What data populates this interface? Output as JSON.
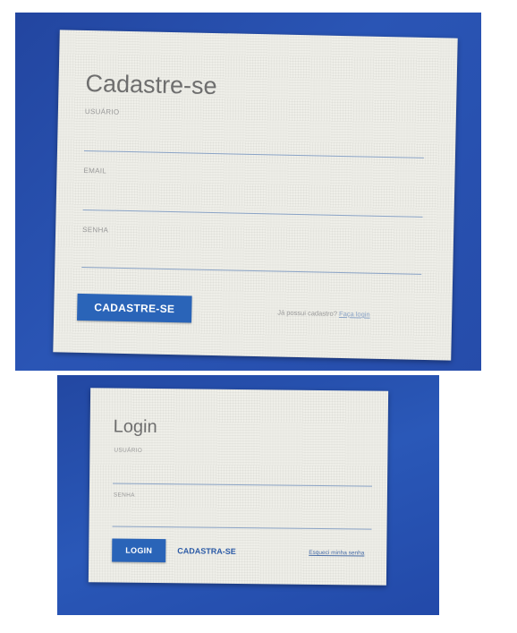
{
  "signup": {
    "title": "Cadastre-se",
    "fields": [
      {
        "label": "USUÁRIO",
        "value": ""
      },
      {
        "label": "EMAIL",
        "value": ""
      },
      {
        "label": "SENHA",
        "value": ""
      }
    ],
    "submit_label": "CADASTRE-SE",
    "footer_text": "Já possui cadastro?",
    "footer_link": "Faça login"
  },
  "login": {
    "title": "Login",
    "fields": [
      {
        "label": "USUÁRIO",
        "value": ""
      },
      {
        "label": "SENHA",
        "value": ""
      }
    ],
    "submit_label": "LOGIN",
    "register_label": "CADASTRA-SE",
    "forgot_link": "Esqueci minha senha"
  },
  "colors": {
    "background_blue": "#2a55b5",
    "card": "#efefe9",
    "primary_button": "#2a64b8",
    "field_underline": "#8aa3c6"
  }
}
